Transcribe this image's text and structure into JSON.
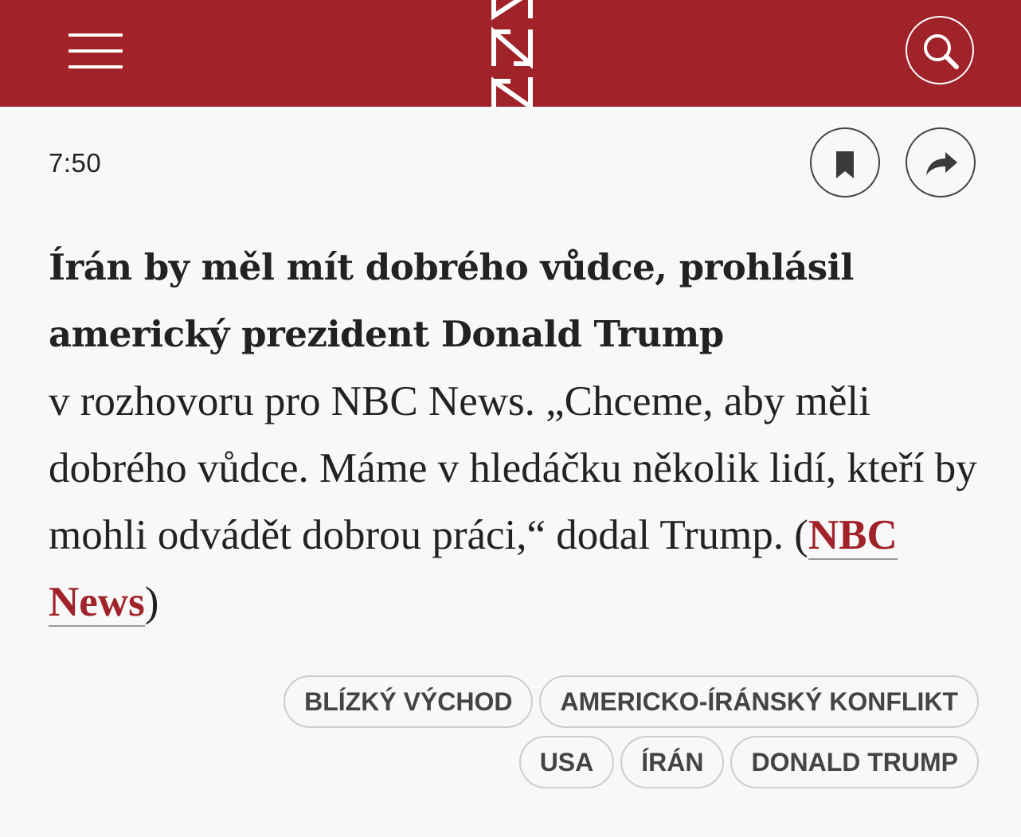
{
  "header": {
    "menu_icon": "hamburger-menu-icon",
    "logo_icon": "denik-n-logo-icon",
    "search_icon": "search-icon",
    "background_color": "#a0232a"
  },
  "post": {
    "time": "7:50",
    "bookmark_icon": "bookmark-icon",
    "share_icon": "share-arrow-icon",
    "headline": "Írán by měl mít dobrého vůdce, prohlásil americký prezident Donald Trump",
    "body_text": "v rozhovoru pro NBC News. „Chceme, aby měli dobrého vůdce. Máme v hledáčku několik lidí, kteří by mohli odvádět dobrou práci,“ dodal Trump. (",
    "source_link": "NBC News",
    "closing_paren": ")",
    "link_color": "#a0232a"
  },
  "tags": [
    "BLÍZKÝ VÝCHOD",
    "AMERICKO-ÍRÁNSKÝ KONFLIKT",
    "USA",
    "ÍRÁN",
    "DONALD TRUMP"
  ]
}
